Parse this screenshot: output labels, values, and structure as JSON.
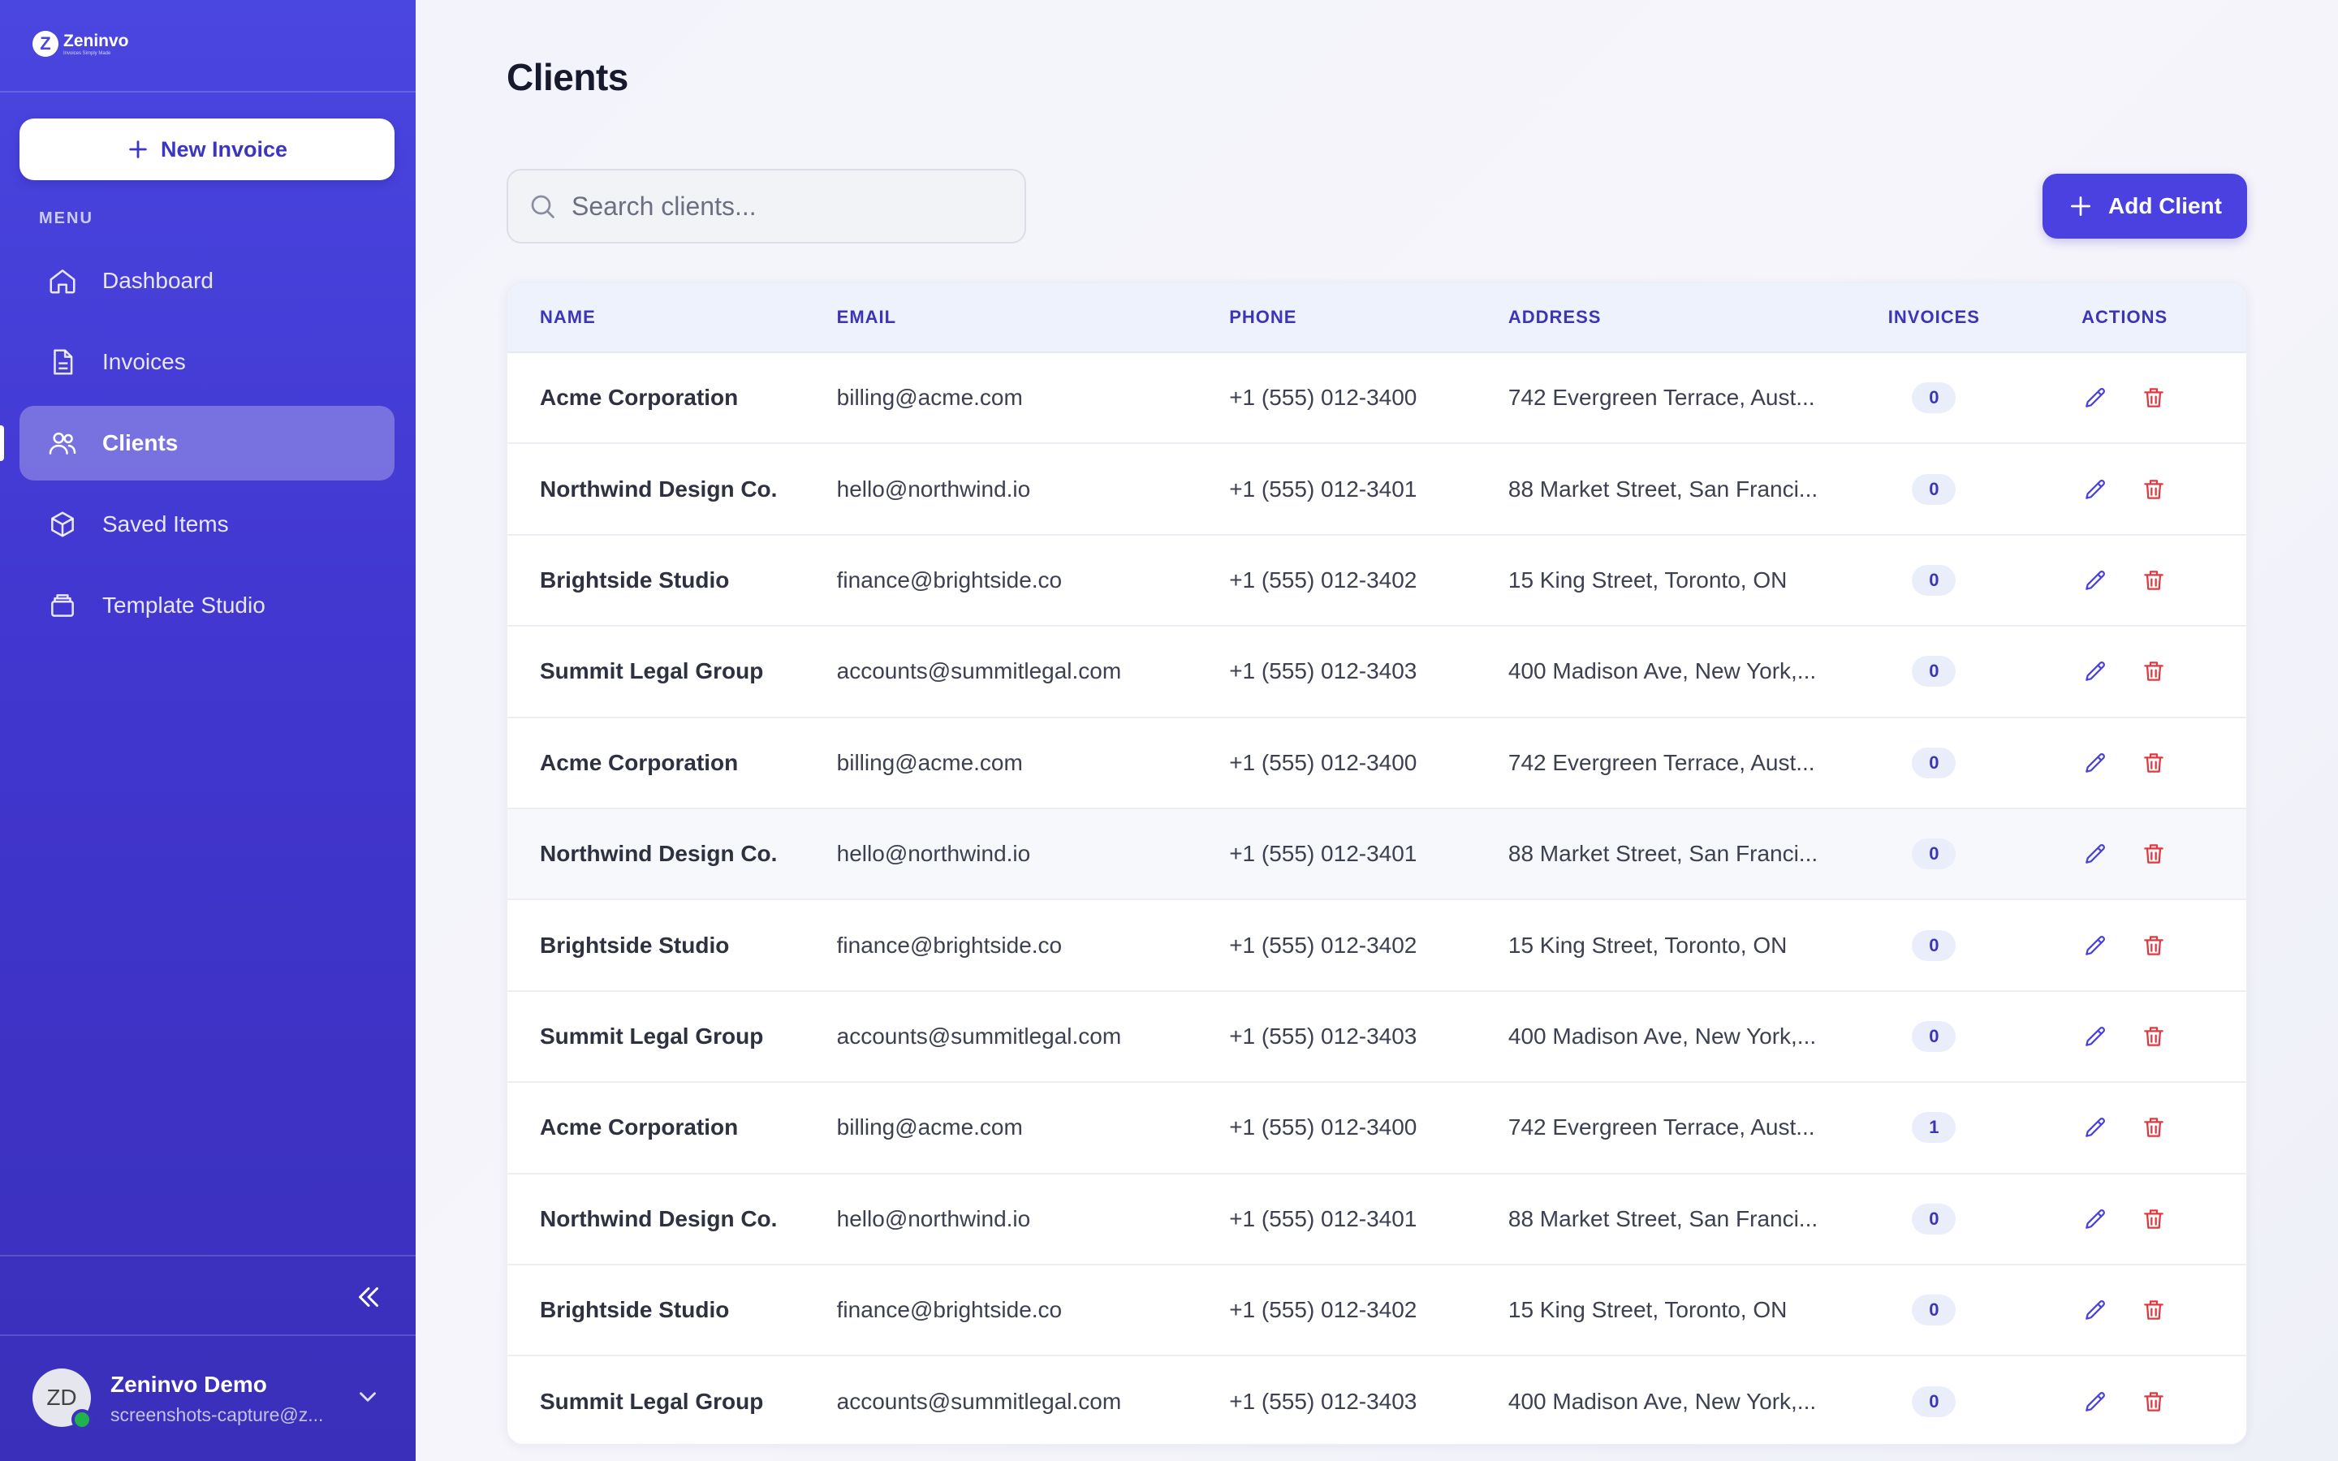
{
  "app": {
    "logo_name": "Zeninvo",
    "logo_tagline": "Invoices Simply Made"
  },
  "sidebar": {
    "new_invoice_label": "New Invoice",
    "menu_label": "MENU",
    "items": [
      {
        "label": "Dashboard",
        "icon": "home-icon",
        "active": false
      },
      {
        "label": "Invoices",
        "icon": "file-icon",
        "active": false
      },
      {
        "label": "Clients",
        "icon": "users-icon",
        "active": true
      },
      {
        "label": "Saved Items",
        "icon": "box-icon",
        "active": false
      },
      {
        "label": "Template Studio",
        "icon": "layers-icon",
        "active": false
      }
    ],
    "user": {
      "initials": "ZD",
      "name": "Zeninvo Demo",
      "email": "screenshots-capture@z..."
    }
  },
  "main": {
    "title": "Clients",
    "search": {
      "placeholder": "Search clients...",
      "value": ""
    },
    "add_client_label": "Add Client",
    "table": {
      "headers": {
        "name": "NAME",
        "email": "EMAIL",
        "phone": "PHONE",
        "address": "ADDRESS",
        "invoices": "INVOICES",
        "actions": "ACTIONS"
      },
      "rows": [
        {
          "name": "Acme Corporation",
          "email": "billing@acme.com",
          "phone": "+1 (555) 012-3400",
          "address": "742 Evergreen Terrace, Aust...",
          "invoices": "0"
        },
        {
          "name": "Northwind Design Co.",
          "email": "hello@northwind.io",
          "phone": "+1 (555) 012-3401",
          "address": "88 Market Street, San Franci...",
          "invoices": "0"
        },
        {
          "name": "Brightside Studio",
          "email": "finance@brightside.co",
          "phone": "+1 (555) 012-3402",
          "address": "15 King Street, Toronto, ON",
          "invoices": "0"
        },
        {
          "name": "Summit Legal Group",
          "email": "accounts@summitlegal.com",
          "phone": "+1 (555) 012-3403",
          "address": "400 Madison Ave, New York,...",
          "invoices": "0"
        },
        {
          "name": "Acme Corporation",
          "email": "billing@acme.com",
          "phone": "+1 (555) 012-3400",
          "address": "742 Evergreen Terrace, Aust...",
          "invoices": "0"
        },
        {
          "name": "Northwind Design Co.",
          "email": "hello@northwind.io",
          "phone": "+1 (555) 012-3401",
          "address": "88 Market Street, San Franci...",
          "invoices": "0"
        },
        {
          "name": "Brightside Studio",
          "email": "finance@brightside.co",
          "phone": "+1 (555) 012-3402",
          "address": "15 King Street, Toronto, ON",
          "invoices": "0"
        },
        {
          "name": "Summit Legal Group",
          "email": "accounts@summitlegal.com",
          "phone": "+1 (555) 012-3403",
          "address": "400 Madison Ave, New York,...",
          "invoices": "0"
        },
        {
          "name": "Acme Corporation",
          "email": "billing@acme.com",
          "phone": "+1 (555) 012-3400",
          "address": "742 Evergreen Terrace, Aust...",
          "invoices": "1"
        },
        {
          "name": "Northwind Design Co.",
          "email": "hello@northwind.io",
          "phone": "+1 (555) 012-3401",
          "address": "88 Market Street, San Franci...",
          "invoices": "0"
        },
        {
          "name": "Brightside Studio",
          "email": "finance@brightside.co",
          "phone": "+1 (555) 012-3402",
          "address": "15 King Street, Toronto, ON",
          "invoices": "0"
        },
        {
          "name": "Summit Legal Group",
          "email": "accounts@summitlegal.com",
          "phone": "+1 (555) 012-3403",
          "address": "400 Madison Ave, New York,...",
          "invoices": "0"
        }
      ]
    }
  },
  "colors": {
    "sidebar_top": "#4a46e0",
    "sidebar_bottom": "#3a2fba",
    "accent": "#4a41e0",
    "delete": "#e0383e",
    "online": "#21b24b"
  }
}
